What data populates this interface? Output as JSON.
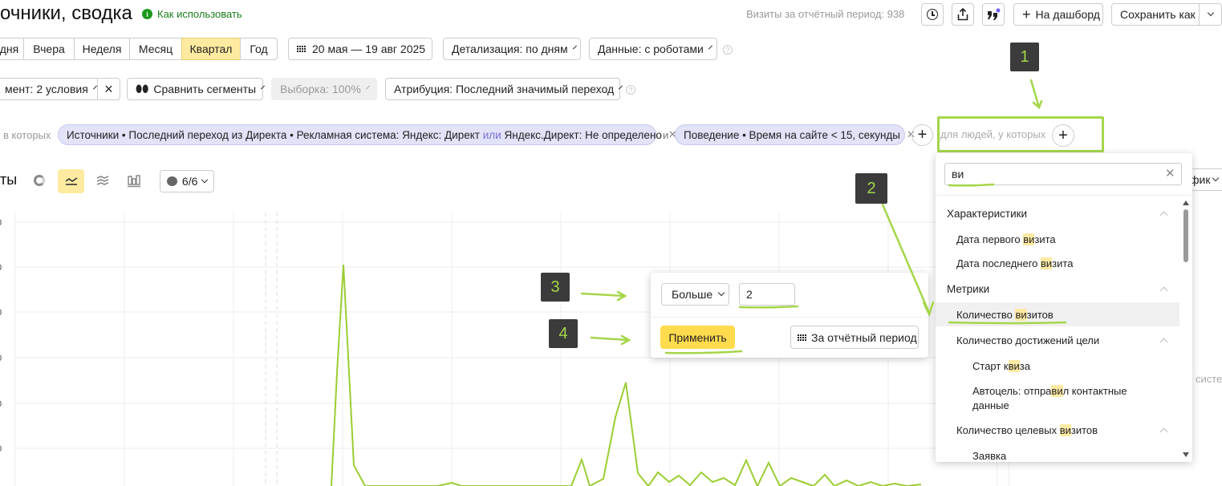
{
  "header": {
    "title": "очники, сводка",
    "how_to_use": "Как использовать",
    "visits_label": "Визиты за отчётный период: 938",
    "dashboard_btn": "На дашборд",
    "save_as_btn": "Сохранить как"
  },
  "periods": [
    "дня",
    "Вчера",
    "Неделя",
    "Месяц",
    "Квартал",
    "Год"
  ],
  "active_period": "Квартал",
  "date_range": "20 мая — 19 авг 2025",
  "detail": "Детализация: по дням",
  "data_mode": "Данные: с роботами",
  "segment": "мент: 2 условия",
  "compare": "Сравнить сегменты",
  "sample": "Выборка: 100%",
  "attribution": "Атрибуция: Последний значимый переход",
  "filters": {
    "prefix": "в которых",
    "chip1_a": "Источники • Последний переход из Директа • Рекламная система: Яндекс: Директ",
    "chip1_or": "или",
    "chip1_b": "Яндекс.Директ: Не определено",
    "and": "и",
    "chip2": "Поведение • Время на сайте < 15, секунды",
    "people_label": "для людей, у которых"
  },
  "chart_toolbar": {
    "label": "ты",
    "comments": "6/6",
    "right_label": "фик"
  },
  "search": {
    "value": "ви"
  },
  "dropdown": {
    "sec1": "Характеристики",
    "i1a": "Дата первого ",
    "i1b": "ви",
    "i1c": "зита",
    "i2a": "Дата последнего ",
    "i2b": "ви",
    "i2c": "зита",
    "sec2": "Метрики",
    "i3a": "Количество ",
    "i3b": "ви",
    "i3c": "зитов",
    "i4": "Количество достижений цели",
    "i5a": "Старт к",
    "i5b": "ви",
    "i5c": "за",
    "i6a": "Автоцель: отпра",
    "i6b": "ви",
    "i6c": "л контактные",
    "i6d": "данные",
    "i7a": "Количество целевых ",
    "i7b": "ви",
    "i7c": "зитов",
    "i8": "Заявка"
  },
  "popup": {
    "operator": "Больше",
    "value": "2",
    "apply": "Применить",
    "period": "За отчётный период"
  },
  "annotations": [
    "1",
    "2",
    "3",
    "4"
  ],
  "side_text": "систе",
  "colors": {
    "accent": "#ffdb4d",
    "annotation": "#a5d64a",
    "chip": "#e2e2f8",
    "line": "#9acd32"
  }
}
